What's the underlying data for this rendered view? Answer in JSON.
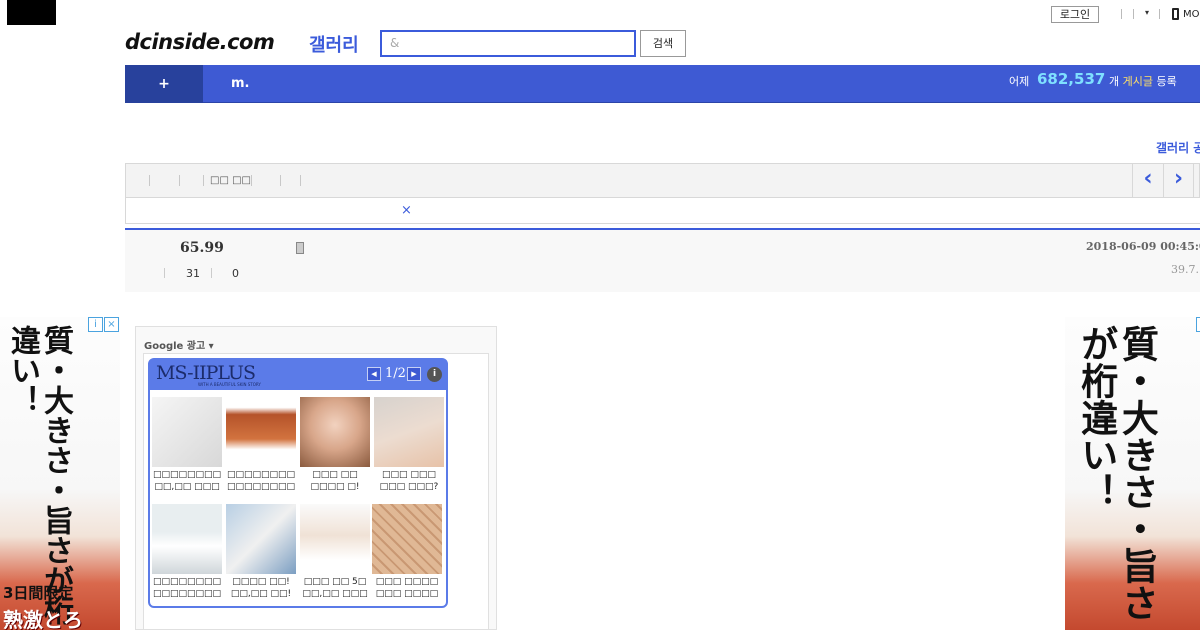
{
  "header": {
    "login_label": "로그인",
    "mobile_label": "MO",
    "logo_text": "dcinside.com",
    "logo_gallery": "갤러리",
    "search_placeholder": "&",
    "search_button": "검색"
  },
  "nav": {
    "plus_label": "+",
    "m_label": "m.",
    "yesterday_label": "어제",
    "yesterday_count": "682,537",
    "posts_unit": "개",
    "posts_word": "게시글",
    "posts_suffix": "등록"
  },
  "notice_link": "갤러리 공",
  "toolbar": {
    "text": "□□ □□",
    "prev_icon": "‹",
    "next_icon": "›"
  },
  "close_icon": "×",
  "post": {
    "title": "65.99",
    "date": "2018-06-09 00:45:0",
    "ip": "39.7.",
    "views": "31",
    "recommends": "0"
  },
  "side_ads": {
    "text": "質・大きさ・旨さが桁違い！",
    "promo1": "3日間限定",
    "promo2": "熟激とろ",
    "close_icons": [
      "i",
      "×"
    ]
  },
  "google_ad": {
    "label": "Google 광고 ▾",
    "brand": "MS-IIPLUS",
    "brand_sub": "WITH A BEAUTIFUL SKIN STORY",
    "page": "1/2",
    "info_icon": "i",
    "prev_icon": "◀",
    "next_icon": "▶",
    "tiles": [
      {
        "caption1": "□□□□□□□□",
        "caption2": "□□,□□ □□□"
      },
      {
        "caption1": "□□□□□□□□",
        "caption2": "□□□□□□□□"
      },
      {
        "caption1": "□□□ □□",
        "caption2": "□□□□ □!"
      },
      {
        "caption1": "□□□ □□□",
        "caption2": "□□□ □□□?"
      },
      {
        "caption1": "□□□□□□□□",
        "caption2": "□□□□□□□□"
      },
      {
        "caption1": "□□□□ □□!",
        "caption2": "□□,□□ □□!"
      },
      {
        "caption1": "□□□ □□ 5□",
        "caption2": "□□,□□ □□□"
      },
      {
        "caption1": "□□□ □□□□",
        "caption2": "□□□ □□□□"
      }
    ]
  }
}
